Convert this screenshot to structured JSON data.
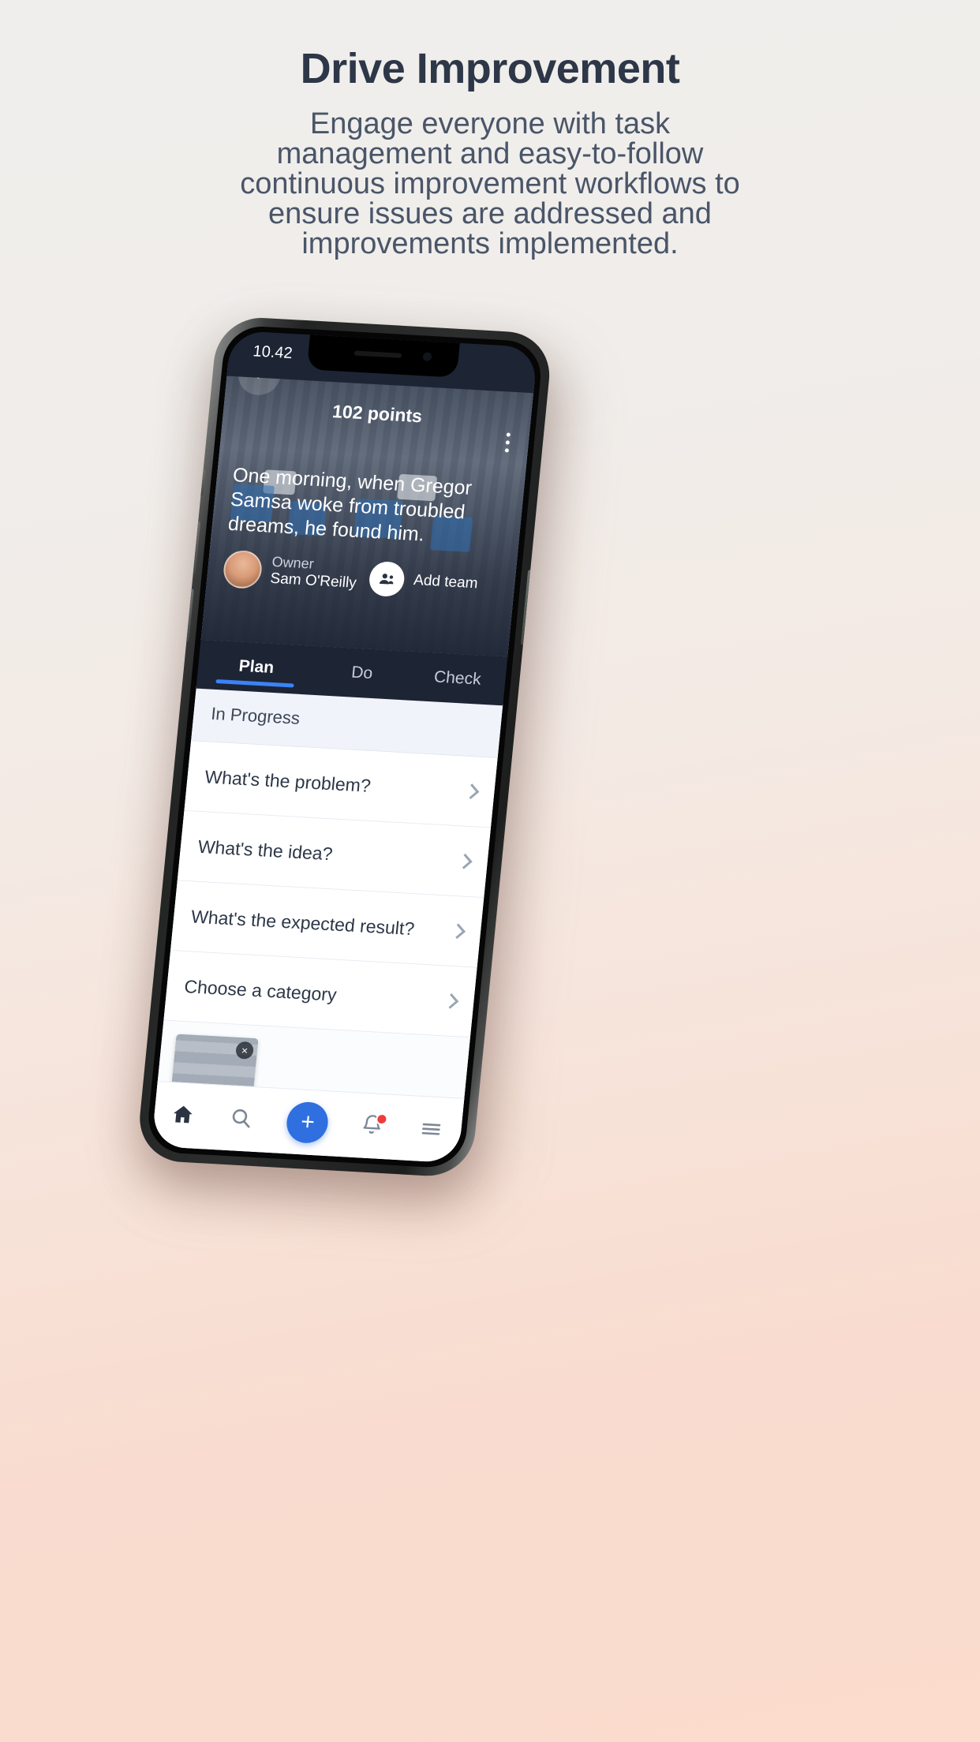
{
  "page": {
    "headline": "Drive Improvement",
    "subcopy_lines": [
      "Engage everyone with task",
      "management and easy-to-follow",
      "continuous improvement workflows to",
      "ensure issues are addressed and",
      "improvements implemented."
    ]
  },
  "phone": {
    "status_bar": {
      "time": "10.42",
      "signal_icon": "cellular-signal-icon",
      "wifi_icon": "wifi-icon",
      "battery_icon": "battery-icon"
    },
    "hero": {
      "back_icon": "back-arrow-icon",
      "points": "102 points",
      "menu_icon": "kebab-menu-icon",
      "story": "One morning, when Gregor Samsa woke from troubled dreams, he found him.",
      "owner_label": "Owner",
      "owner_name": "Sam O'Reilly",
      "add_team_label": "Add team",
      "add_team_icon": "add-team-icon",
      "avatar_icon": "avatar"
    },
    "tabs": [
      {
        "label": "Plan",
        "active": true
      },
      {
        "label": "Do",
        "active": false
      },
      {
        "label": "Check",
        "active": false
      }
    ],
    "list": {
      "section_title": "In Progress",
      "rows": [
        {
          "label": "What's the problem?",
          "chevron": "chevron-right-icon"
        },
        {
          "label": "What's the idea?",
          "chevron": "chevron-right-icon"
        },
        {
          "label": "What's the expected result?",
          "chevron": "chevron-right-icon"
        },
        {
          "label": "Choose a category",
          "chevron": "chevron-right-icon"
        }
      ],
      "attachment": {
        "remove_label": "×",
        "thumb_icon": "attachment-thumbnail"
      }
    },
    "bottom_nav": [
      {
        "icon": "home-icon",
        "label": ""
      },
      {
        "icon": "search-icon",
        "label": ""
      },
      {
        "icon": "add-icon",
        "label": "+"
      },
      {
        "icon": "bell-icon",
        "label": ""
      },
      {
        "icon": "menu-icon",
        "label": ""
      }
    ]
  },
  "colors": {
    "accent_blue": "#2f6fe0",
    "tab_underline": "#3b82f6",
    "dark_panel": "#1d2434",
    "notification_red": "#ef3b3b",
    "title_text": "#2d3748"
  }
}
